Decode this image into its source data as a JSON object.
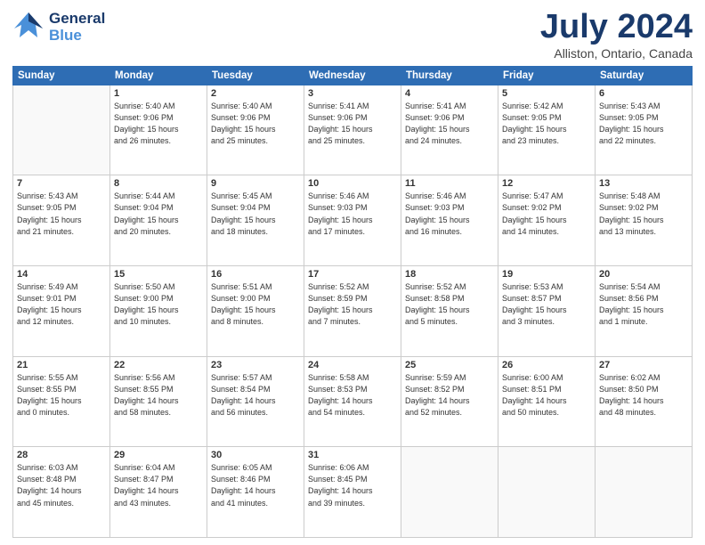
{
  "header": {
    "logo": {
      "general": "General",
      "blue": "Blue"
    },
    "title": "July 2024",
    "location": "Alliston, Ontario, Canada"
  },
  "weekdays": [
    "Sunday",
    "Monday",
    "Tuesday",
    "Wednesday",
    "Thursday",
    "Friday",
    "Saturday"
  ],
  "weeks": [
    [
      {
        "day": "",
        "sunrise": "",
        "sunset": "",
        "daylight": ""
      },
      {
        "day": "1",
        "sunrise": "Sunrise: 5:40 AM",
        "sunset": "Sunset: 9:06 PM",
        "daylight": "Daylight: 15 hours and 26 minutes."
      },
      {
        "day": "2",
        "sunrise": "Sunrise: 5:40 AM",
        "sunset": "Sunset: 9:06 PM",
        "daylight": "Daylight: 15 hours and 25 minutes."
      },
      {
        "day": "3",
        "sunrise": "Sunrise: 5:41 AM",
        "sunset": "Sunset: 9:06 PM",
        "daylight": "Daylight: 15 hours and 25 minutes."
      },
      {
        "day": "4",
        "sunrise": "Sunrise: 5:41 AM",
        "sunset": "Sunset: 9:06 PM",
        "daylight": "Daylight: 15 hours and 24 minutes."
      },
      {
        "day": "5",
        "sunrise": "Sunrise: 5:42 AM",
        "sunset": "Sunset: 9:05 PM",
        "daylight": "Daylight: 15 hours and 23 minutes."
      },
      {
        "day": "6",
        "sunrise": "Sunrise: 5:43 AM",
        "sunset": "Sunset: 9:05 PM",
        "daylight": "Daylight: 15 hours and 22 minutes."
      }
    ],
    [
      {
        "day": "7",
        "sunrise": "Sunrise: 5:43 AM",
        "sunset": "Sunset: 9:05 PM",
        "daylight": "Daylight: 15 hours and 21 minutes."
      },
      {
        "day": "8",
        "sunrise": "Sunrise: 5:44 AM",
        "sunset": "Sunset: 9:04 PM",
        "daylight": "Daylight: 15 hours and 20 minutes."
      },
      {
        "day": "9",
        "sunrise": "Sunrise: 5:45 AM",
        "sunset": "Sunset: 9:04 PM",
        "daylight": "Daylight: 15 hours and 18 minutes."
      },
      {
        "day": "10",
        "sunrise": "Sunrise: 5:46 AM",
        "sunset": "Sunset: 9:03 PM",
        "daylight": "Daylight: 15 hours and 17 minutes."
      },
      {
        "day": "11",
        "sunrise": "Sunrise: 5:46 AM",
        "sunset": "Sunset: 9:03 PM",
        "daylight": "Daylight: 15 hours and 16 minutes."
      },
      {
        "day": "12",
        "sunrise": "Sunrise: 5:47 AM",
        "sunset": "Sunset: 9:02 PM",
        "daylight": "Daylight: 15 hours and 14 minutes."
      },
      {
        "day": "13",
        "sunrise": "Sunrise: 5:48 AM",
        "sunset": "Sunset: 9:02 PM",
        "daylight": "Daylight: 15 hours and 13 minutes."
      }
    ],
    [
      {
        "day": "14",
        "sunrise": "Sunrise: 5:49 AM",
        "sunset": "Sunset: 9:01 PM",
        "daylight": "Daylight: 15 hours and 12 minutes."
      },
      {
        "day": "15",
        "sunrise": "Sunrise: 5:50 AM",
        "sunset": "Sunset: 9:00 PM",
        "daylight": "Daylight: 15 hours and 10 minutes."
      },
      {
        "day": "16",
        "sunrise": "Sunrise: 5:51 AM",
        "sunset": "Sunset: 9:00 PM",
        "daylight": "Daylight: 15 hours and 8 minutes."
      },
      {
        "day": "17",
        "sunrise": "Sunrise: 5:52 AM",
        "sunset": "Sunset: 8:59 PM",
        "daylight": "Daylight: 15 hours and 7 minutes."
      },
      {
        "day": "18",
        "sunrise": "Sunrise: 5:52 AM",
        "sunset": "Sunset: 8:58 PM",
        "daylight": "Daylight: 15 hours and 5 minutes."
      },
      {
        "day": "19",
        "sunrise": "Sunrise: 5:53 AM",
        "sunset": "Sunset: 8:57 PM",
        "daylight": "Daylight: 15 hours and 3 minutes."
      },
      {
        "day": "20",
        "sunrise": "Sunrise: 5:54 AM",
        "sunset": "Sunset: 8:56 PM",
        "daylight": "Daylight: 15 hours and 1 minute."
      }
    ],
    [
      {
        "day": "21",
        "sunrise": "Sunrise: 5:55 AM",
        "sunset": "Sunset: 8:55 PM",
        "daylight": "Daylight: 15 hours and 0 minutes."
      },
      {
        "day": "22",
        "sunrise": "Sunrise: 5:56 AM",
        "sunset": "Sunset: 8:55 PM",
        "daylight": "Daylight: 14 hours and 58 minutes."
      },
      {
        "day": "23",
        "sunrise": "Sunrise: 5:57 AM",
        "sunset": "Sunset: 8:54 PM",
        "daylight": "Daylight: 14 hours and 56 minutes."
      },
      {
        "day": "24",
        "sunrise": "Sunrise: 5:58 AM",
        "sunset": "Sunset: 8:53 PM",
        "daylight": "Daylight: 14 hours and 54 minutes."
      },
      {
        "day": "25",
        "sunrise": "Sunrise: 5:59 AM",
        "sunset": "Sunset: 8:52 PM",
        "daylight": "Daylight: 14 hours and 52 minutes."
      },
      {
        "day": "26",
        "sunrise": "Sunrise: 6:00 AM",
        "sunset": "Sunset: 8:51 PM",
        "daylight": "Daylight: 14 hours and 50 minutes."
      },
      {
        "day": "27",
        "sunrise": "Sunrise: 6:02 AM",
        "sunset": "Sunset: 8:50 PM",
        "daylight": "Daylight: 14 hours and 48 minutes."
      }
    ],
    [
      {
        "day": "28",
        "sunrise": "Sunrise: 6:03 AM",
        "sunset": "Sunset: 8:48 PM",
        "daylight": "Daylight: 14 hours and 45 minutes."
      },
      {
        "day": "29",
        "sunrise": "Sunrise: 6:04 AM",
        "sunset": "Sunset: 8:47 PM",
        "daylight": "Daylight: 14 hours and 43 minutes."
      },
      {
        "day": "30",
        "sunrise": "Sunrise: 6:05 AM",
        "sunset": "Sunset: 8:46 PM",
        "daylight": "Daylight: 14 hours and 41 minutes."
      },
      {
        "day": "31",
        "sunrise": "Sunrise: 6:06 AM",
        "sunset": "Sunset: 8:45 PM",
        "daylight": "Daylight: 14 hours and 39 minutes."
      },
      {
        "day": "",
        "sunrise": "",
        "sunset": "",
        "daylight": ""
      },
      {
        "day": "",
        "sunrise": "",
        "sunset": "",
        "daylight": ""
      },
      {
        "day": "",
        "sunrise": "",
        "sunset": "",
        "daylight": ""
      }
    ]
  ]
}
